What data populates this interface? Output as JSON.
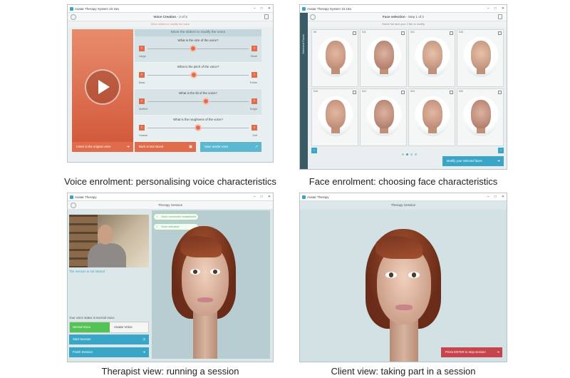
{
  "panels": {
    "voice": {
      "window_title": "Avatar Therapy System 10.15a",
      "header_title": "Voice Creation",
      "header_step": "- 2 of 3",
      "hint": "Move sliders to modify the voice",
      "sliders_heading": "Move the sliders to modify the voice",
      "sliders": [
        {
          "question": "What is the size of the voice?",
          "low": "Large",
          "high": "Small",
          "level": 0.45
        },
        {
          "question": "What is the pitch of the voice?",
          "low": "Bass",
          "high": "Treble",
          "level": 0.46
        },
        {
          "question": "What is the tilt of the voice?",
          "low": "Muffled",
          "high": "Bright",
          "level": 0.58
        },
        {
          "question": "What is the roughness of the voice?",
          "low": "Hoarse",
          "high": "Soft",
          "level": 0.5
        }
      ],
      "buttons": {
        "listen_original": "Listen to the original voice",
        "back_last_saved": "Back to last saved",
        "save_voice": "Save avatar voice"
      }
    },
    "face": {
      "window_title": "Avatar Therapy System 10.15a",
      "header_title": "Face selection",
      "header_step": "- Step 1 of 2",
      "hint": "Select the face your 3 like to modify",
      "side_label": "Selected Faces",
      "faces": [
        {
          "id": "05"
        },
        {
          "id": "011"
        },
        {
          "id": "021"
        },
        {
          "id": "033"
        },
        {
          "id": "016"
        },
        {
          "id": "012"
        },
        {
          "id": "024"
        },
        {
          "id": "020"
        }
      ],
      "modify_button": "Modify your selected faces"
    },
    "therapist": {
      "window_title": "Avatar Therapy",
      "header_title": "Therapy Session",
      "status": "The session is not started",
      "voice_status": "Your voice status is Normal Voice",
      "normal_voice": "Normal Voice",
      "avatar_voice": "Avatar Voice",
      "start_session": "Start Session",
      "finish_session": "Finish Session",
      "bubbles": [
        "Voice connection established",
        "Voice activated"
      ]
    },
    "client": {
      "window_title": "Avatar Therapy",
      "header_title": "Therapy Session",
      "stop_button": "Press ENTER to stop session"
    }
  },
  "captions": {
    "voice": "Voice enrolment: personalising voice characteristics",
    "face": "Face enrolment: choosing face characteristics",
    "therapist": "Therapist view: running a session",
    "client": "Client view: taking part in a session"
  },
  "colors": {
    "accent": "#3aa6c7",
    "orange": "#e06c4c",
    "green": "#55c255",
    "stop_red": "#c8444c"
  }
}
